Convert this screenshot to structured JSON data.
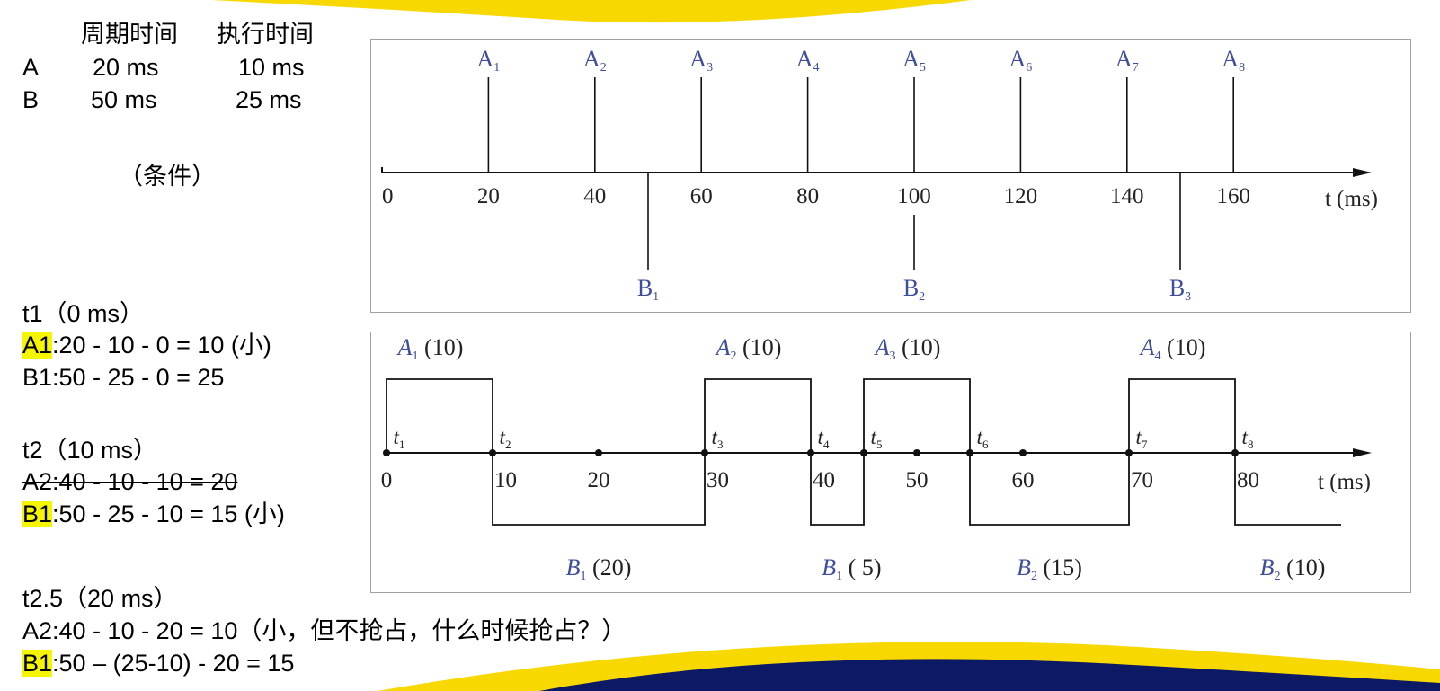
{
  "table": {
    "header": {
      "period": "周期时间",
      "exec": "执行时间"
    },
    "rows": [
      {
        "task": "A",
        "period": "20 ms",
        "exec": "10 ms"
      },
      {
        "task": "B",
        "period": "50 ms",
        "exec": "25 ms"
      }
    ],
    "caption": "（条件）"
  },
  "notes": {
    "t1": {
      "title": "t1（0 ms）",
      "a1_tag": "A1",
      "a1_text": ":20 - 10 - 0 = 10 (小)",
      "b1_text": "B1:50 -  25 - 0 = 25"
    },
    "t2": {
      "title": "t2（10 ms）",
      "a2_text": "A2:40 - 10 - 10 = 20",
      "b1_tag": "B1",
      "b1_text": ":50 -  25 - 10 = 15 (小)"
    },
    "t25": {
      "title": "t2.5（20 ms）",
      "a2_text": "A2:40 - 10 - 20 = 10（小，但不抢占，什么时候抢占？）",
      "b1_tag": "B1",
      "b1_text": ":50 – (25-10) - 20 = 15"
    }
  },
  "colors": {
    "label_blue": "#3f4e9a",
    "highlight": "#f5f500",
    "banner_yellow": "#f7d800",
    "banner_navy": "#0c1a66"
  },
  "diagram1": {
    "ticks": [
      "0",
      "20",
      "40",
      "60",
      "80",
      "100",
      "120",
      "140",
      "160"
    ],
    "tick_values": [
      0,
      20,
      40,
      60,
      80,
      100,
      120,
      140,
      160
    ],
    "axis_label": "t (ms)",
    "a_events": [
      {
        "name": "A",
        "sub": "1",
        "time": 20
      },
      {
        "name": "A",
        "sub": "2",
        "time": 40
      },
      {
        "name": "A",
        "sub": "3",
        "time": 60
      },
      {
        "name": "A",
        "sub": "4",
        "time": 80
      },
      {
        "name": "A",
        "sub": "5",
        "time": 100
      },
      {
        "name": "A",
        "sub": "6",
        "time": 120
      },
      {
        "name": "A",
        "sub": "7",
        "time": 140
      },
      {
        "name": "A",
        "sub": "8",
        "time": 160
      }
    ],
    "b_events": [
      {
        "name": "B",
        "sub": "1",
        "time": 50
      },
      {
        "name": "B",
        "sub": "2",
        "time": 100
      },
      {
        "name": "B",
        "sub": "3",
        "time": 150
      }
    ]
  },
  "diagram2": {
    "ticks": [
      "0",
      "10",
      "20",
      "30",
      "40",
      "50",
      "60",
      "70",
      "80"
    ],
    "tick_values": [
      0,
      10,
      20,
      30,
      40,
      50,
      60,
      70,
      80
    ],
    "axis_label": "t (ms)",
    "t_marks": [
      {
        "name": "t",
        "sub": "1",
        "time": 0
      },
      {
        "name": "t",
        "sub": "2",
        "time": 10
      },
      {
        "name": "t",
        "sub": "3",
        "time": 30
      },
      {
        "name": "t",
        "sub": "4",
        "time": 40
      },
      {
        "name": "t",
        "sub": "5",
        "time": 45
      },
      {
        "name": "t",
        "sub": "6",
        "time": 55
      },
      {
        "name": "t",
        "sub": "7",
        "time": 70
      },
      {
        "name": "t",
        "sub": "8",
        "time": 80
      }
    ],
    "a_blocks": [
      {
        "name": "A",
        "sub": "1",
        "value": "(10)",
        "start": 0,
        "end": 10
      },
      {
        "name": "A",
        "sub": "2",
        "value": "(10)",
        "start": 30,
        "end": 40
      },
      {
        "name": "A",
        "sub": "3",
        "value": "(10)",
        "start": 45,
        "end": 55
      },
      {
        "name": "A",
        "sub": "4",
        "value": "(10)",
        "start": 70,
        "end": 80
      }
    ],
    "b_blocks": [
      {
        "name": "B",
        "sub": "1",
        "value": "(20)",
        "start": 10,
        "end": 30
      },
      {
        "name": "B",
        "sub": "1",
        "value": "( 5)",
        "start": 40,
        "end": 45
      },
      {
        "name": "B",
        "sub": "2",
        "value": "(15)",
        "start": 55,
        "end": 70
      },
      {
        "name": "B",
        "sub": "2",
        "value": "(10)",
        "start": 80,
        "end": 90
      }
    ]
  }
}
